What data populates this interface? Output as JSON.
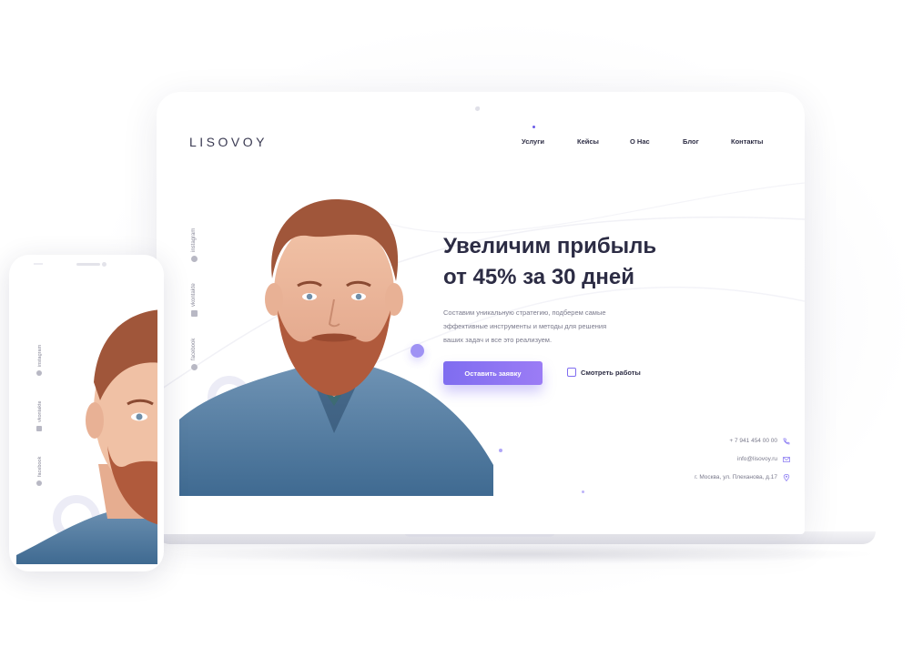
{
  "brand": {
    "logo": "LISOVOY"
  },
  "nav": {
    "items": [
      {
        "label": "Услуги",
        "active": true
      },
      {
        "label": "Кейсы",
        "active": false
      },
      {
        "label": "О Нас",
        "active": false
      },
      {
        "label": "Блог",
        "active": false
      },
      {
        "label": "Контакты",
        "active": false
      }
    ]
  },
  "social": {
    "items": [
      {
        "label": "instagram",
        "icon": "instagram-icon"
      },
      {
        "label": "vkontakte",
        "icon": "vk-icon"
      },
      {
        "label": "facebook",
        "icon": "facebook-icon"
      }
    ]
  },
  "hero": {
    "headline_line1": "Увеличим прибыль",
    "headline_line2": "от 45% за 30 дней",
    "subtext_line1": "Составим уникальную стратегию, подберем  самые",
    "subtext_line2": "эффективные инструменты и методы  для решения",
    "subtext_line3": "ваших задач и все это реализуем.",
    "cta_label": "Оставить заявку",
    "works_label": "Смотреть работы"
  },
  "contacts": {
    "phone": "+ 7 941 454 00 00",
    "email": "info@lisovoy.ru",
    "address": "г. Москва, ул. Плеханова, д.17"
  },
  "colors": {
    "accent": "#7f6df0",
    "text_dark": "#2c2c44",
    "text_muted": "#7a7a8c"
  }
}
